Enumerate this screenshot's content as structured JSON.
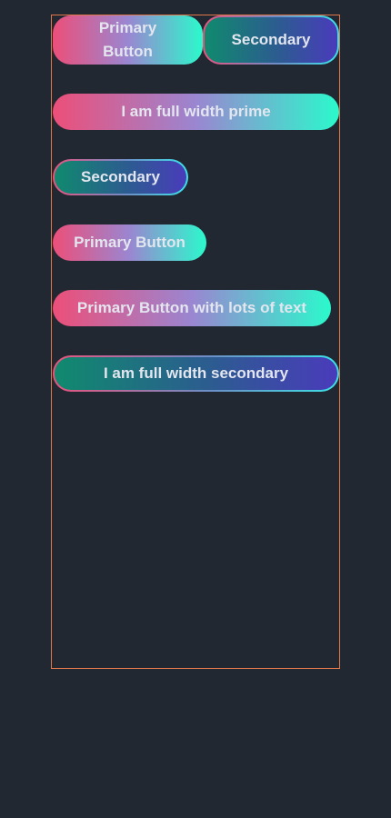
{
  "buttons": {
    "primary_button_wrapped": "Primary Button",
    "secondary_top": "Secondary",
    "full_width_prime": "I am full width prime",
    "secondary_small": "Secondary",
    "primary_button": "Primary Button",
    "primary_long": "Primary Button with lots of text",
    "full_width_secondary": "I am full width secondary"
  },
  "colors": {
    "background": "#222831",
    "frame_border": "#e0774a",
    "primary_gradient": [
      "#ec4f79",
      "#9a86d1",
      "#2bf9cc"
    ],
    "secondary_fill_gradient": [
      "#108a6e",
      "#2c5c90",
      "#4a3bbb"
    ],
    "secondary_border_gradient": [
      "#e9537d",
      "#6c8fc8",
      "#3ae3e6"
    ],
    "label": "#e3e6ee"
  }
}
